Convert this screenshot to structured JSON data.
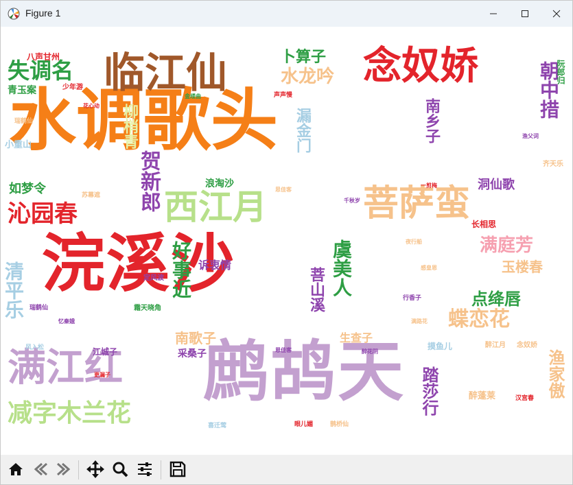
{
  "window": {
    "title": "Figure 1"
  },
  "toolbar": {
    "buttons": [
      "home-icon",
      "back-icon",
      "forward-icon",
      "pan-icon",
      "zoom-icon",
      "configure-subplots-icon",
      "save-icon"
    ]
  },
  "wordcloud": {
    "words": [
      "浣溪沙",
      "水调歌头",
      "鹧鸪天",
      "满江红",
      "临江仙",
      "念奴娇",
      "菩萨蛮",
      "西江月",
      "沁园春",
      "减字木兰花",
      "失调名",
      "卜算子",
      "水龙吟",
      "朝中措",
      "蝶恋花",
      "满庭芳",
      "玉楼春",
      "点绛唇",
      "贺新郎",
      "好事近",
      "虞美人",
      "南歌子",
      "踏莎行",
      "渔家傲",
      "清平乐",
      "如梦令",
      "南乡子",
      "洞仙歌",
      "漏金门",
      "柳梢青",
      "生查子",
      "采桑子",
      "诉衷情",
      "菩山溪",
      "浪淘沙",
      "江城子",
      "青玉案",
      "八声甘州",
      "醉蓬莱",
      "长相思",
      "小重山",
      "阮郎归",
      "少年游",
      "花心动",
      "汉宫春",
      "瑞鹤仙",
      "定风波",
      "醉江月",
      "念奴娇",
      "行香子",
      "摸鱼儿",
      "齐天乐",
      "眼儿媚",
      "鹊桥仙",
      "一剪梅",
      "千秋岁",
      "苏幕遮",
      "满路花",
      "感皇恩",
      "恩佳客",
      "渔父词",
      "夜行船",
      "霜天晓角",
      "风入松",
      "更漏子",
      "瑞鹤仙",
      "醉花阴",
      "忆秦娥",
      "思佳客",
      "喜迁莺",
      "声声慢",
      "金缕曲"
    ]
  }
}
